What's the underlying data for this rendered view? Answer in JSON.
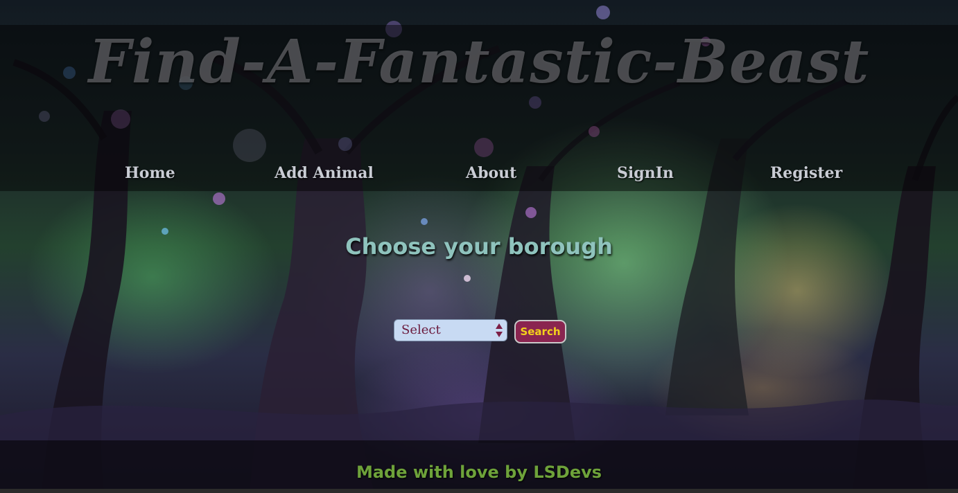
{
  "header": {
    "title": "Find-A-Fantastic-Beast"
  },
  "nav": {
    "items": [
      {
        "label": "Home"
      },
      {
        "label": "Add Animal"
      },
      {
        "label": "About"
      },
      {
        "label": "SignIn"
      },
      {
        "label": "Register"
      }
    ]
  },
  "main": {
    "heading": "Choose your borough",
    "borough_select": {
      "selected": "Select"
    },
    "search_label": "Search"
  },
  "footer": {
    "text": "Made with love by LSDevs"
  },
  "colors": {
    "heading": "#8fc3bd",
    "button_bg": "#8a2550",
    "button_text": "#f3d21b",
    "select_bg": "#c8daf3",
    "footer_text": "#6ea23a"
  }
}
